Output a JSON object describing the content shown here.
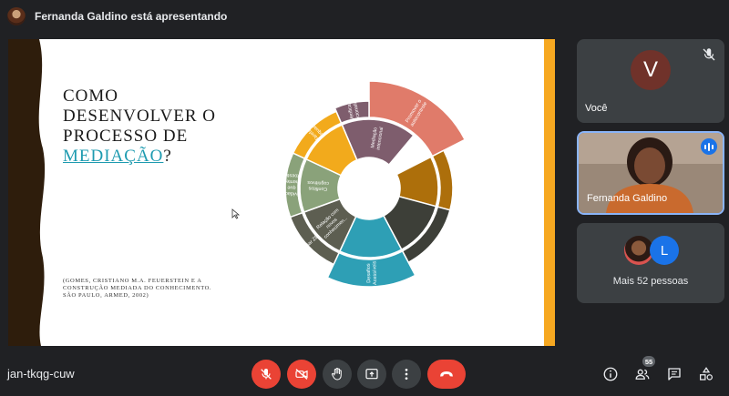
{
  "presenter_banner": "Fernanda Galdino está apresentando",
  "slide": {
    "title_lines": [
      "COMO",
      "DESENVOLVER O",
      "PROCESSO DE"
    ],
    "title_highlight": "MEDIAÇÃO",
    "title_suffix": "?",
    "citation_lines": [
      "(GOMES, CRISTIANO M.A. FEUERSTEIN E A",
      "CONSTRUÇÃO MEDIADA DO CONHECIMENTO.",
      "SÃO PAULO, ARMED, 2002)"
    ],
    "wheel": {
      "inner": [
        {
          "label": "Mediação intencional",
          "color": "#7e5d6d"
        },
        {
          "label": "",
          "color": "#ad6f0b"
        },
        {
          "label": "",
          "color": "#3d3f38"
        },
        {
          "label": "",
          "color": "#2e9fb5"
        },
        {
          "label": "Relação com novos conhecimen...",
          "color": "#5d5e51"
        },
        {
          "label": "Conflitos cognitivos",
          "color": "#8aa27a"
        },
        {
          "label": "",
          "color": "#f2aa1c"
        }
      ],
      "outer": [
        {
          "label": "Promover o autocontrole",
          "color": "#e07b6a"
        },
        {
          "label": "",
          "color": "#ad6f0b"
        },
        {
          "label": "",
          "color": "#3d3f38"
        },
        {
          "label": "Desafios Acessíveis",
          "color": "#2e9fb5"
        },
        {
          "label": "Criar ZDP",
          "color": "#5d5e51"
        },
        {
          "label": "Atividades que aumentem a autoestima",
          "color": "#8aa27a"
        },
        {
          "label": "Tarefa adequadas",
          "color": "#f2aa1c"
        },
        {
          "label": "Verificar intencionalidade",
          "color": "#7e5d6d"
        }
      ]
    }
  },
  "participants": {
    "you_initial": "V",
    "you_label": "Você",
    "speaker_label": "Fernanda Galdino",
    "more_initial": "L",
    "more_label": "Mais 52 pessoas"
  },
  "controls": {
    "meeting_code": "jan-tkqg-cuw",
    "people_count": "55"
  },
  "colors": {
    "background": "#202124",
    "tile": "#3c4043",
    "danger": "#ea4335",
    "accent": "#1a73e8",
    "slide_stripe": "#f6a821"
  }
}
